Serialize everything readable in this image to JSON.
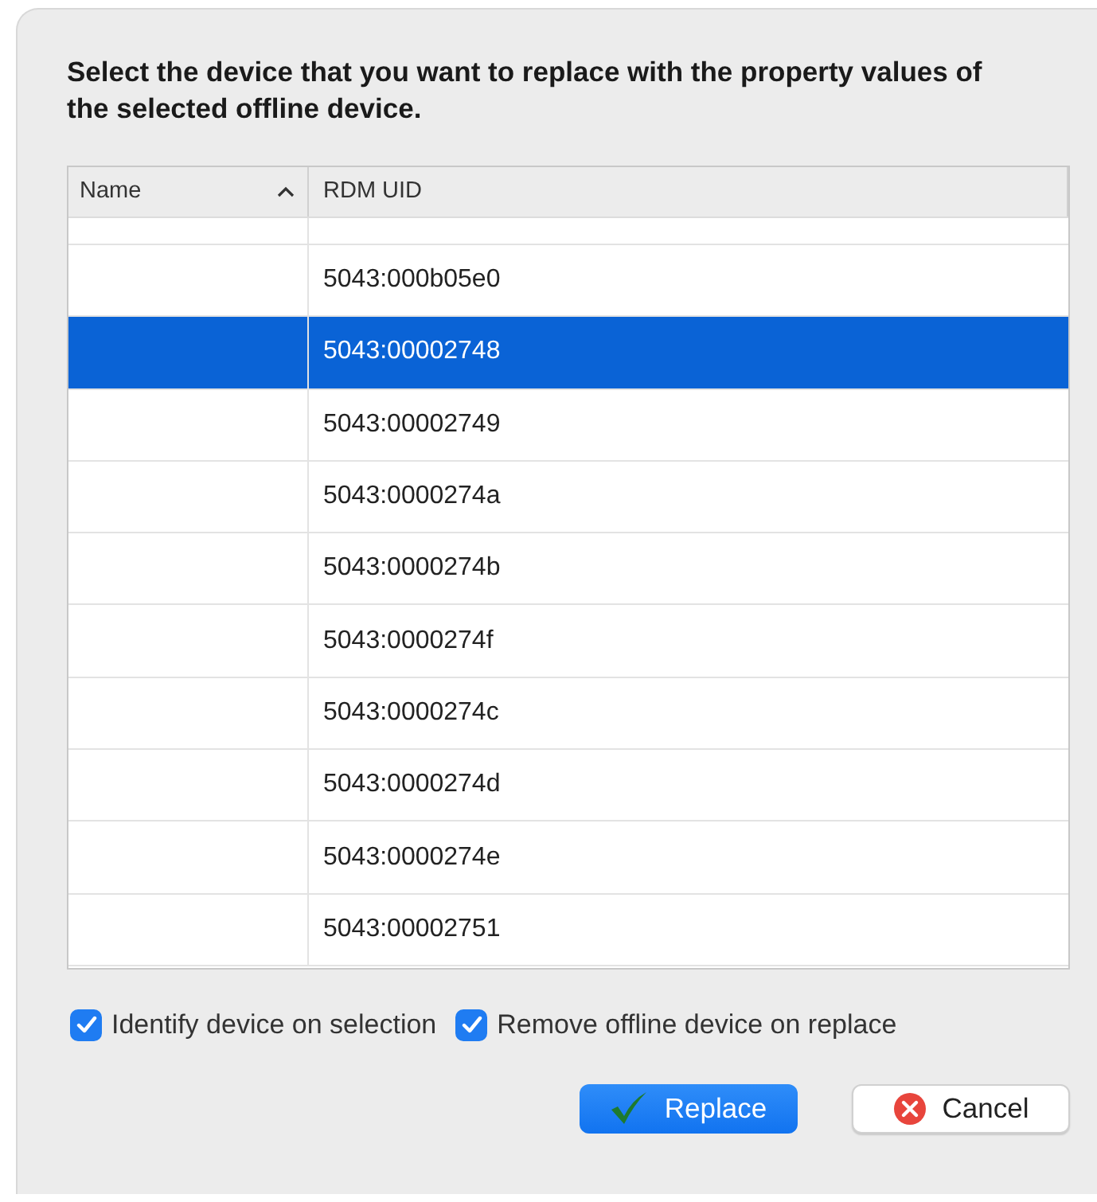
{
  "dialog": {
    "heading": "Select the device that you want to replace with the property values of the selected offline device."
  },
  "table": {
    "columns": [
      {
        "label": "Name",
        "sorted": true
      },
      {
        "label": "RDM UID",
        "sorted": false
      }
    ],
    "partial_top_row": true,
    "rows": [
      {
        "uid": "5043:000b05e0",
        "selected": false
      },
      {
        "uid": "5043:00002748",
        "selected": true
      },
      {
        "uid": "5043:00002749",
        "selected": false
      },
      {
        "uid": "5043:0000274a",
        "selected": false
      },
      {
        "uid": "5043:0000274b",
        "selected": false
      },
      {
        "uid": "5043:0000274f",
        "selected": false
      },
      {
        "uid": "5043:0000274c",
        "selected": false
      },
      {
        "uid": "5043:0000274d",
        "selected": false
      },
      {
        "uid": "5043:0000274e",
        "selected": false
      },
      {
        "uid": "5043:00002751",
        "selected": false
      }
    ]
  },
  "options": [
    {
      "label": "Identify device on selection",
      "checked": true
    },
    {
      "label": "Remove offline device on replace",
      "checked": true
    }
  ],
  "buttons": [
    {
      "label": "Replace",
      "kind": "primary"
    },
    {
      "label": "Cancel",
      "kind": "cancel"
    }
  ]
}
